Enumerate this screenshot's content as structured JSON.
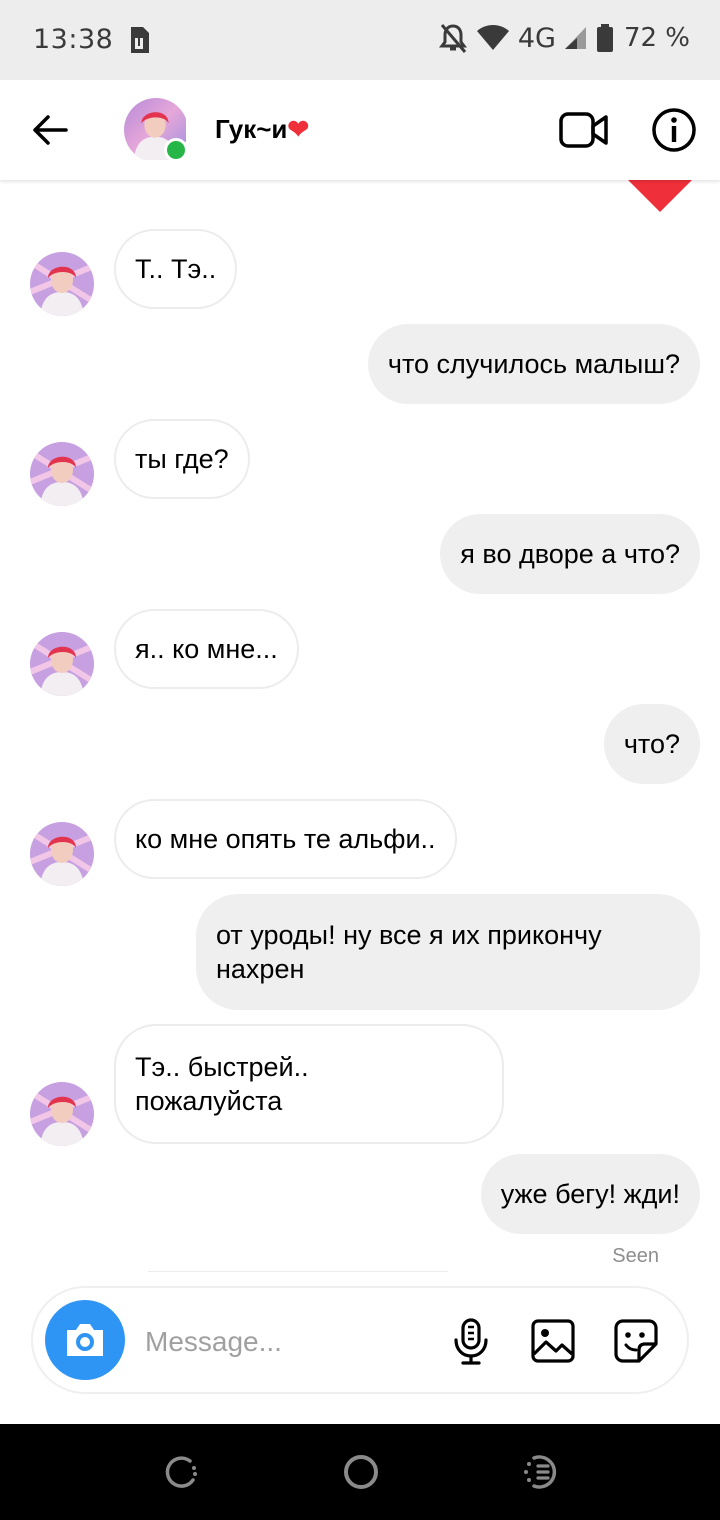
{
  "status_bar": {
    "time": "13:38",
    "network": "4G",
    "battery_pct": "72 %"
  },
  "header": {
    "contact_name": "Гук~и",
    "heart": "❤",
    "online": true
  },
  "messages": [
    {
      "side": "in",
      "text": "Т.. Тэ.."
    },
    {
      "side": "out",
      "text": "что случилось малыш?"
    },
    {
      "side": "in",
      "text": "ты где?"
    },
    {
      "side": "out",
      "text": "я во дворе а что?"
    },
    {
      "side": "in",
      "text": "я.. ко мне..."
    },
    {
      "side": "out",
      "text": "что?"
    },
    {
      "side": "in",
      "text": "ко мне опять те альфи.."
    },
    {
      "side": "out",
      "line1": "от уроды! ну все я их прикончу",
      "line2": "нахрен"
    },
    {
      "side": "in",
      "line1": "Тэ.. быстрей..",
      "line2": "пожалуйста"
    },
    {
      "side": "out",
      "text": "уже бегу! жди!"
    }
  ],
  "seen_label": "Seen",
  "composer": {
    "placeholder": "Message..."
  },
  "colors": {
    "accent_blue": "#2f95f5",
    "online_green": "#26b648",
    "heart_red": "#ef2f3a",
    "outgoing_bubble": "#efefef"
  },
  "icons": [
    "back-arrow-icon",
    "video-call-icon",
    "info-icon",
    "camera-icon",
    "microphone-icon",
    "gallery-icon",
    "sticker-icon",
    "recent-apps-icon",
    "home-icon",
    "assistant-icon"
  ]
}
